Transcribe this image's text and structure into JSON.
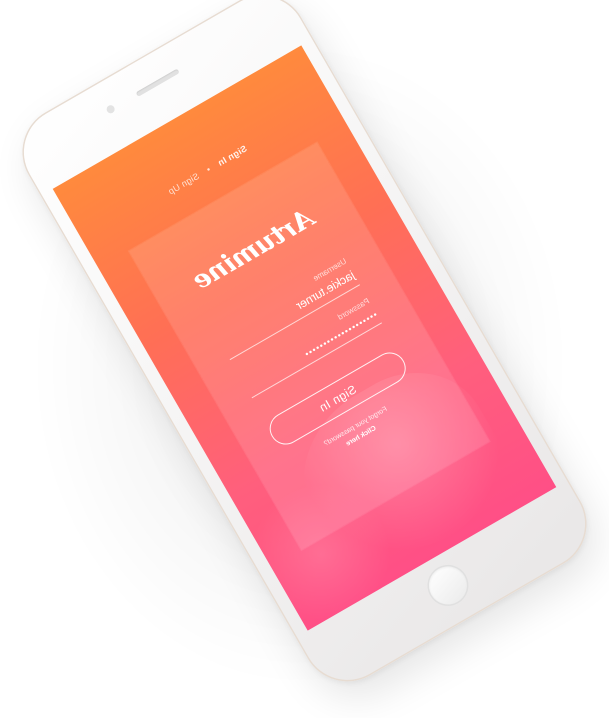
{
  "nav": {
    "signin": "Sign In",
    "separator": "•",
    "signup": "Sign Up"
  },
  "logo": "Artumine",
  "form": {
    "username_label": "Username",
    "username_value": "jackie.turner",
    "password_label": "Password",
    "password_value": "••••••••••••••••••••",
    "signin_label": "Sign In",
    "forgot_text": "Forgot your password?",
    "forgot_link": "Click here"
  },
  "colors": {
    "gradient_top": "#ff8a3d",
    "gradient_bottom": "#ff4f86",
    "text": "#ffffff"
  }
}
